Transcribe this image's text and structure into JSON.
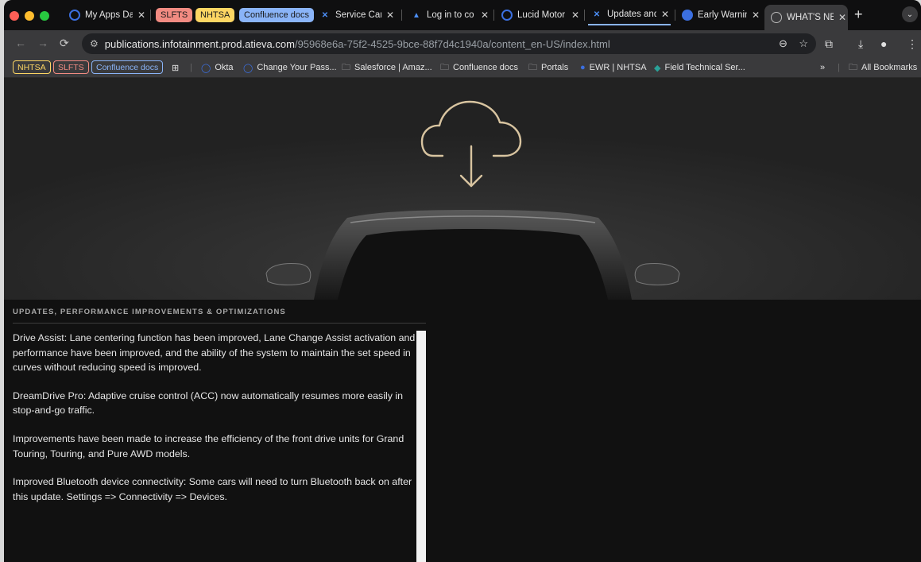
{
  "browser": {
    "tabs": [
      {
        "title": "My Apps Da",
        "active": false
      },
      {
        "title": "Service Car",
        "active": false
      },
      {
        "title": "Log in to co",
        "active": false
      },
      {
        "title": "Lucid Motor",
        "active": false
      },
      {
        "title": "Updates and",
        "active": false
      },
      {
        "title": "Early Warnin",
        "active": false
      },
      {
        "title": "WHAT'S NE",
        "active": true
      }
    ],
    "tab_groups": [
      {
        "label": "SLFTS",
        "color": "#f28b82"
      },
      {
        "label": "NHTSA",
        "color": "#fdd663"
      },
      {
        "label": "Confluence docs",
        "color": "#8ab4f8"
      }
    ],
    "url_host": "publications.infotainment.prod.atieva.com",
    "url_path": "/95968e6a-75f2-4525-9bce-88f7d4c1940a/content_en-US/index.html",
    "bookmarks": {
      "group_chips": [
        {
          "label": "NHTSA",
          "color": "#fdd663"
        },
        {
          "label": "SLFTS",
          "color": "#f28b82"
        },
        {
          "label": "Confluence docs",
          "color": "#8ab4f8"
        }
      ],
      "items": [
        {
          "label": "Okta",
          "icon": "okta-icon"
        },
        {
          "label": "Change Your Pass...",
          "icon": "okta-icon"
        },
        {
          "label": "Salesforce | Amaz...",
          "icon": "folder-icon"
        },
        {
          "label": "Confluence docs",
          "icon": "folder-icon"
        },
        {
          "label": "Portals",
          "icon": "folder-icon"
        },
        {
          "label": "EWR | NHTSA",
          "icon": "globe-icon"
        },
        {
          "label": "Field Technical Ser...",
          "icon": "sharepoint-icon"
        }
      ],
      "overflow": "»",
      "all_bookmarks": "All Bookmarks"
    }
  },
  "page": {
    "section_title": "UPDATES, PERFORMANCE IMPROVEMENTS & OPTIMIZATIONS",
    "paragraphs": [
      "Drive Assist: Lane centering function has been improved, Lane Change Assist activation and performance have been improved, and the ability of the system to maintain the set speed in curves without reducing speed is improved.",
      "DreamDrive Pro: Adaptive cruise control (ACC) now automatically resumes more easily in stop-and-go traffic.",
      "Improvements have been made to increase the efficiency of the front drive units for Grand Touring, Touring, and Pure AWD models.",
      "Improved Bluetooth device connectivity: Some cars will need to turn Bluetooth back on after this update. Settings => Connectivity => Devices."
    ],
    "hero_icons": [
      "cloud-download-icon",
      "car-image"
    ],
    "colors": {
      "accent_cloud": "#d8c4a0",
      "background": "#111111"
    }
  }
}
